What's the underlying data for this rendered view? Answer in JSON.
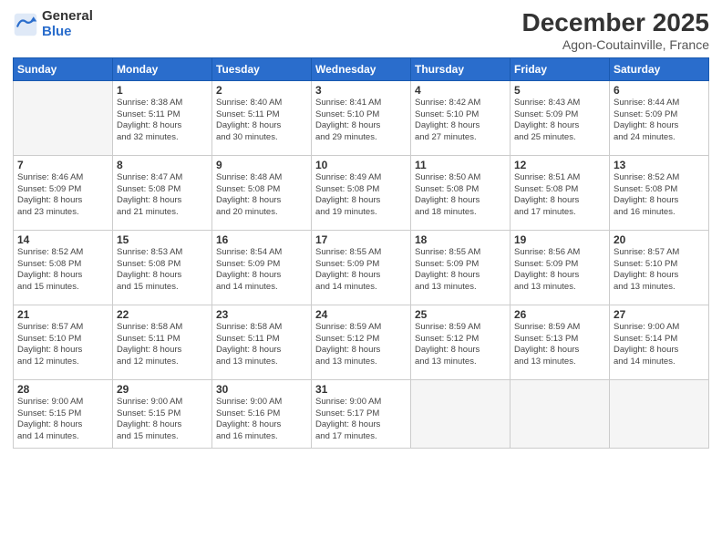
{
  "header": {
    "logo_general": "General",
    "logo_blue": "Blue",
    "month_title": "December 2025",
    "location": "Agon-Coutainville, France"
  },
  "weekdays": [
    "Sunday",
    "Monday",
    "Tuesday",
    "Wednesday",
    "Thursday",
    "Friday",
    "Saturday"
  ],
  "weeks": [
    [
      {
        "day": "",
        "info": ""
      },
      {
        "day": "1",
        "info": "Sunrise: 8:38 AM\nSunset: 5:11 PM\nDaylight: 8 hours\nand 32 minutes."
      },
      {
        "day": "2",
        "info": "Sunrise: 8:40 AM\nSunset: 5:11 PM\nDaylight: 8 hours\nand 30 minutes."
      },
      {
        "day": "3",
        "info": "Sunrise: 8:41 AM\nSunset: 5:10 PM\nDaylight: 8 hours\nand 29 minutes."
      },
      {
        "day": "4",
        "info": "Sunrise: 8:42 AM\nSunset: 5:10 PM\nDaylight: 8 hours\nand 27 minutes."
      },
      {
        "day": "5",
        "info": "Sunrise: 8:43 AM\nSunset: 5:09 PM\nDaylight: 8 hours\nand 25 minutes."
      },
      {
        "day": "6",
        "info": "Sunrise: 8:44 AM\nSunset: 5:09 PM\nDaylight: 8 hours\nand 24 minutes."
      }
    ],
    [
      {
        "day": "7",
        "info": "Sunrise: 8:46 AM\nSunset: 5:09 PM\nDaylight: 8 hours\nand 23 minutes."
      },
      {
        "day": "8",
        "info": "Sunrise: 8:47 AM\nSunset: 5:08 PM\nDaylight: 8 hours\nand 21 minutes."
      },
      {
        "day": "9",
        "info": "Sunrise: 8:48 AM\nSunset: 5:08 PM\nDaylight: 8 hours\nand 20 minutes."
      },
      {
        "day": "10",
        "info": "Sunrise: 8:49 AM\nSunset: 5:08 PM\nDaylight: 8 hours\nand 19 minutes."
      },
      {
        "day": "11",
        "info": "Sunrise: 8:50 AM\nSunset: 5:08 PM\nDaylight: 8 hours\nand 18 minutes."
      },
      {
        "day": "12",
        "info": "Sunrise: 8:51 AM\nSunset: 5:08 PM\nDaylight: 8 hours\nand 17 minutes."
      },
      {
        "day": "13",
        "info": "Sunrise: 8:52 AM\nSunset: 5:08 PM\nDaylight: 8 hours\nand 16 minutes."
      }
    ],
    [
      {
        "day": "14",
        "info": "Sunrise: 8:52 AM\nSunset: 5:08 PM\nDaylight: 8 hours\nand 15 minutes."
      },
      {
        "day": "15",
        "info": "Sunrise: 8:53 AM\nSunset: 5:08 PM\nDaylight: 8 hours\nand 15 minutes."
      },
      {
        "day": "16",
        "info": "Sunrise: 8:54 AM\nSunset: 5:09 PM\nDaylight: 8 hours\nand 14 minutes."
      },
      {
        "day": "17",
        "info": "Sunrise: 8:55 AM\nSunset: 5:09 PM\nDaylight: 8 hours\nand 14 minutes."
      },
      {
        "day": "18",
        "info": "Sunrise: 8:55 AM\nSunset: 5:09 PM\nDaylight: 8 hours\nand 13 minutes."
      },
      {
        "day": "19",
        "info": "Sunrise: 8:56 AM\nSunset: 5:09 PM\nDaylight: 8 hours\nand 13 minutes."
      },
      {
        "day": "20",
        "info": "Sunrise: 8:57 AM\nSunset: 5:10 PM\nDaylight: 8 hours\nand 13 minutes."
      }
    ],
    [
      {
        "day": "21",
        "info": "Sunrise: 8:57 AM\nSunset: 5:10 PM\nDaylight: 8 hours\nand 12 minutes."
      },
      {
        "day": "22",
        "info": "Sunrise: 8:58 AM\nSunset: 5:11 PM\nDaylight: 8 hours\nand 12 minutes."
      },
      {
        "day": "23",
        "info": "Sunrise: 8:58 AM\nSunset: 5:11 PM\nDaylight: 8 hours\nand 13 minutes."
      },
      {
        "day": "24",
        "info": "Sunrise: 8:59 AM\nSunset: 5:12 PM\nDaylight: 8 hours\nand 13 minutes."
      },
      {
        "day": "25",
        "info": "Sunrise: 8:59 AM\nSunset: 5:12 PM\nDaylight: 8 hours\nand 13 minutes."
      },
      {
        "day": "26",
        "info": "Sunrise: 8:59 AM\nSunset: 5:13 PM\nDaylight: 8 hours\nand 13 minutes."
      },
      {
        "day": "27",
        "info": "Sunrise: 9:00 AM\nSunset: 5:14 PM\nDaylight: 8 hours\nand 14 minutes."
      }
    ],
    [
      {
        "day": "28",
        "info": "Sunrise: 9:00 AM\nSunset: 5:15 PM\nDaylight: 8 hours\nand 14 minutes."
      },
      {
        "day": "29",
        "info": "Sunrise: 9:00 AM\nSunset: 5:15 PM\nDaylight: 8 hours\nand 15 minutes."
      },
      {
        "day": "30",
        "info": "Sunrise: 9:00 AM\nSunset: 5:16 PM\nDaylight: 8 hours\nand 16 minutes."
      },
      {
        "day": "31",
        "info": "Sunrise: 9:00 AM\nSunset: 5:17 PM\nDaylight: 8 hours\nand 17 minutes."
      },
      {
        "day": "",
        "info": ""
      },
      {
        "day": "",
        "info": ""
      },
      {
        "day": "",
        "info": ""
      }
    ]
  ]
}
